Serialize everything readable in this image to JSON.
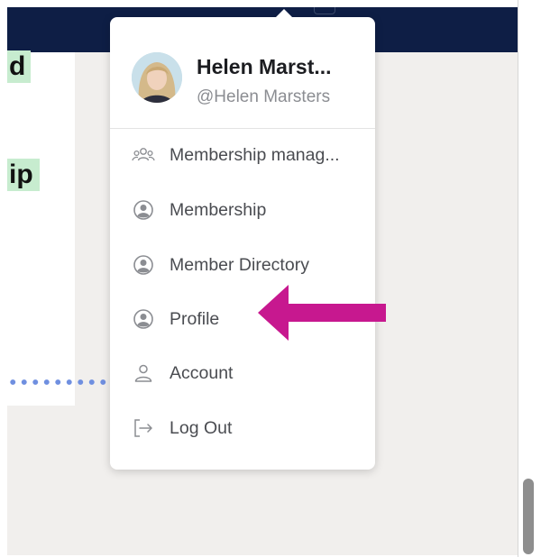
{
  "page": {
    "left_highlights": [
      "d",
      "ip"
    ],
    "arrow_color": "#c7188f"
  },
  "profile": {
    "name": "Helen Marst...",
    "handle": "@Helen Marsters"
  },
  "menu": {
    "items": [
      {
        "label": "Membership manag...",
        "icon": "people-group-icon"
      },
      {
        "label": "Membership",
        "icon": "user-circle-icon"
      },
      {
        "label": "Member Directory",
        "icon": "user-circle-icon"
      },
      {
        "label": "Profile",
        "icon": "user-circle-icon"
      },
      {
        "label": "Account",
        "icon": "user-icon"
      },
      {
        "label": "Log Out",
        "icon": "logout-icon"
      }
    ]
  },
  "colors": {
    "topbar": "#0e1e45",
    "highlight": "#c7eccf",
    "dots": "#6f8fe0"
  }
}
